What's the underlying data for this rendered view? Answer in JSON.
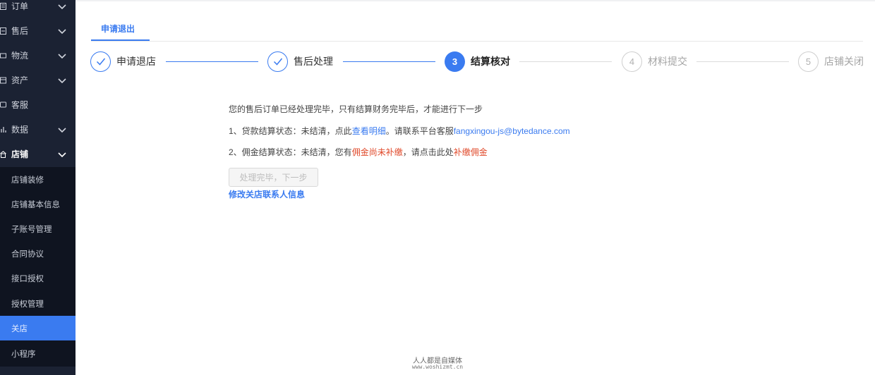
{
  "sidebar": {
    "items": [
      {
        "label": "订单",
        "icon": "order-icon"
      },
      {
        "label": "售后",
        "icon": "aftersale-icon"
      },
      {
        "label": "物流",
        "icon": "logistics-icon"
      },
      {
        "label": "资产",
        "icon": "asset-icon"
      },
      {
        "label": "客服",
        "icon": "service-icon"
      },
      {
        "label": "数据",
        "icon": "data-icon"
      },
      {
        "label": "店铺",
        "icon": "shop-icon"
      }
    ],
    "sub_items": [
      {
        "label": "店铺装修"
      },
      {
        "label": "店铺基本信息"
      },
      {
        "label": "子账号管理"
      },
      {
        "label": "合同协议"
      },
      {
        "label": "接口授权"
      },
      {
        "label": "授权管理"
      },
      {
        "label": "关店"
      },
      {
        "label": "小程序"
      }
    ],
    "active_sub": "关店"
  },
  "tab": {
    "label": "申请退出"
  },
  "steps": [
    {
      "number": "1",
      "label": "申请退店",
      "status": "done"
    },
    {
      "number": "2",
      "label": "售后处理",
      "status": "done"
    },
    {
      "number": "3",
      "label": "结算核对",
      "status": "current"
    },
    {
      "number": "4",
      "label": "材料提交",
      "status": "todo"
    },
    {
      "number": "5",
      "label": "店铺关闭",
      "status": "todo"
    }
  ],
  "content": {
    "intro": "您的售后订单已经处理完毕，只有结算财务完毕后，才能进行下一步",
    "line1": {
      "prefix": "1、贷款结算状态：未结清，点此",
      "link": "查看明细",
      "middle": "。请联系平台客服",
      "email": "fangxingou-js@bytedance.com"
    },
    "line2": {
      "prefix": "2、佣金结算状态：未结清，您有",
      "red_text": "佣金尚未补缴",
      "middle": "，请点击此处",
      "red_link": "补缴佣金"
    },
    "next_button": "处理完毕，下一步",
    "modify_link": "修改关店联系人信息"
  },
  "watermark": {
    "line1": "人人都是自媒体",
    "line2": "www.woshizmt.cn"
  },
  "colors": {
    "accent": "#3a7bf0",
    "sidebar_bg": "#1b2233",
    "warning_red": "#e0492a"
  }
}
